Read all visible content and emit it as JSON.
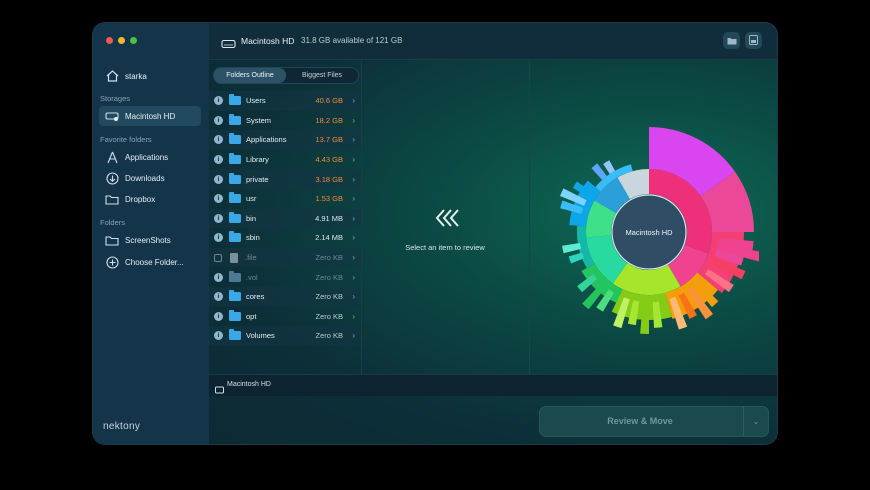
{
  "sidebar": {
    "user": "starka",
    "storages_header": "Storages",
    "storage": "Macintosh HD",
    "favorites_header": "Favorite folders",
    "favorites": [
      {
        "label": "Applications",
        "icon": "applications-icon"
      },
      {
        "label": "Downloads",
        "icon": "download-icon"
      },
      {
        "label": "Dropbox",
        "icon": "folder-icon"
      }
    ],
    "folders_header": "Folders",
    "folders": [
      {
        "label": "ScreenShots",
        "icon": "folder-icon"
      },
      {
        "label": "Choose Folder...",
        "icon": "plus-circle-icon"
      }
    ],
    "brand": "nektony"
  },
  "topbar": {
    "disk": "Macintosh HD",
    "available": "31.8 GB available of 121 GB"
  },
  "tabs": {
    "outline": "Folders Outline",
    "biggest": "Biggest Files",
    "active": "outline"
  },
  "list": [
    {
      "name": "Users",
      "size": "40.6 GB",
      "color": "#f0893a",
      "kind": "folder",
      "checked": "info"
    },
    {
      "name": "System",
      "size": "18.2 GB",
      "color": "#f0893a",
      "kind": "folder",
      "checked": "info"
    },
    {
      "name": "Applications",
      "size": "13.7 GB",
      "color": "#f0893a",
      "kind": "folder",
      "checked": "info"
    },
    {
      "name": "Library",
      "size": "4.43 GB",
      "color": "#f0893a",
      "kind": "folder",
      "checked": "info"
    },
    {
      "name": "private",
      "size": "3.18 GB",
      "color": "#f0893a",
      "kind": "folder",
      "checked": "info"
    },
    {
      "name": "usr",
      "size": "1.53 GB",
      "color": "#f0893a",
      "kind": "folder",
      "checked": "info"
    },
    {
      "name": "bin",
      "size": "4.91 MB",
      "color": "#dde6eb",
      "kind": "folder",
      "checked": "info"
    },
    {
      "name": "sbin",
      "size": "2.14 MB",
      "color": "#dde6eb",
      "kind": "folder",
      "checked": "info"
    },
    {
      "name": ".file",
      "size": "Zero KB",
      "color": "#6f8893",
      "kind": "file",
      "checked": "box"
    },
    {
      "name": ".vol",
      "size": "Zero KB",
      "color": "#6f8893",
      "kind": "folder",
      "checked": "info"
    },
    {
      "name": "cores",
      "size": "Zero KB",
      "color": "#b9c9d2",
      "kind": "folder",
      "checked": "info"
    },
    {
      "name": "opt",
      "size": "Zero KB",
      "color": "#b9c9d2",
      "kind": "folder",
      "checked": "info"
    },
    {
      "name": "Volumes",
      "size": "Zero KB",
      "color": "#b9c9d2",
      "kind": "folder",
      "checked": "info"
    }
  ],
  "review": {
    "hint": "Select an item to review"
  },
  "chart": {
    "center_label": "Macintosh HD"
  },
  "bottombar": {
    "path": "Macintosh HD"
  },
  "action": {
    "label": "Review & Move"
  }
}
